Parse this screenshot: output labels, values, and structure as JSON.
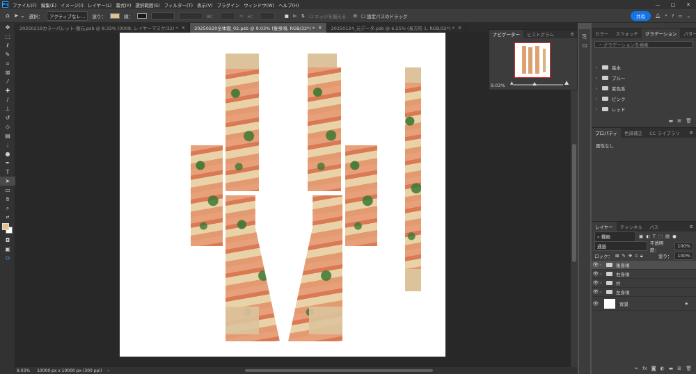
{
  "app": {
    "logo": "Ps"
  },
  "menu": [
    "ファイル(F)",
    "編集(E)",
    "イメージ(I)",
    "レイヤー(L)",
    "書式(Y)",
    "選択範囲(S)",
    "フィルター(T)",
    "表示(V)",
    "プラグイン",
    "ウィンドウ(W)",
    "ヘルプ(H)"
  ],
  "window_controls": {
    "min": "—",
    "max": "□",
    "close": "✕"
  },
  "options": {
    "select_label": "選択：",
    "select_value": "アクティブなレ…",
    "fill_label": "塗り：",
    "fill_color": "#e3c08e",
    "stroke_label": "線：",
    "w_label": "W：",
    "h_label": "H：",
    "align_edges": "エッジを揃える",
    "constrain_path": "固定パスのドラッグ",
    "share": "共有"
  },
  "tabs": [
    {
      "label": "20250219カラーパレット-復元.psb @ 8.33% (0008, レイヤーマスク/32) *",
      "active": false
    },
    {
      "label": "20250220全体図_02.psb @ 9.03% (後身頃, RGB/32*) *",
      "active": true
    },
    {
      "label": "20250124_元データ.psb @ 6.25% (長方形 1, RGB/32*) *",
      "active": false
    }
  ],
  "status": {
    "zoom": "9.03%",
    "doc_info": "10000 px x 10000 px (300 ppi)",
    "arrow": "›"
  },
  "navigator": {
    "tabs": [
      "ナビゲーター",
      "ヒストグラム"
    ],
    "zoom": "9.03%"
  },
  "gradient_panel": {
    "tabs": [
      "カラー",
      "スウォッチ",
      "グラデーション",
      "パターン"
    ],
    "active_tab": 2,
    "search_placeholder": "グラデーションを検索",
    "groups": [
      "基本",
      "ブルー",
      "紫色系",
      "ピンク",
      "レッド"
    ]
  },
  "properties_panel": {
    "tabs": [
      "プロパティ",
      "色調補正",
      "CC ライブラリ"
    ],
    "content": "属性なし"
  },
  "layers_panel": {
    "tabs": [
      "レイヤー",
      "チャンネル",
      "パス"
    ],
    "filter_label": "種類",
    "blend_mode": "通過",
    "opacity_label": "不透明度：",
    "opacity": "100%",
    "lock_label": "ロック：",
    "fill_label": "塗り：",
    "fill": "100%",
    "layers": [
      {
        "name": "後身頃",
        "type": "group",
        "selected": true
      },
      {
        "name": "右身頃",
        "type": "group",
        "selected": false
      },
      {
        "name": "衿",
        "type": "group",
        "selected": false
      },
      {
        "name": "左身頃",
        "type": "group",
        "selected": false
      },
      {
        "name": "背景",
        "type": "background",
        "selected": false
      }
    ]
  },
  "colors": {
    "foreground": "#e3c08e",
    "background": "#ffffff",
    "accent": "#1473e6"
  }
}
